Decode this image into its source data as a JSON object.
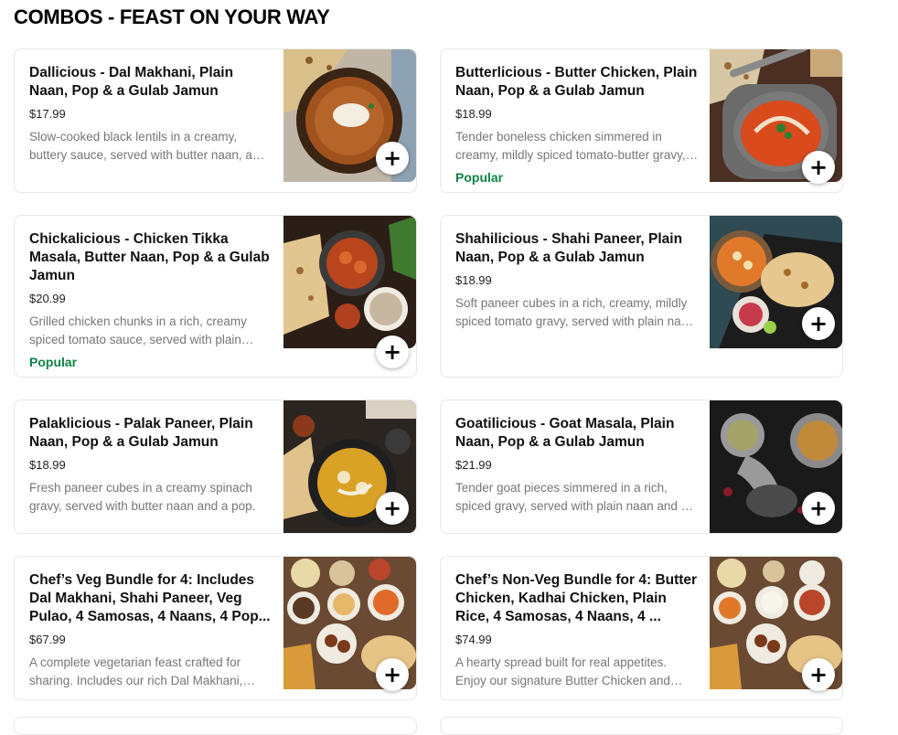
{
  "section": {
    "title": "COMBOS - FEAST ON YOUR WAY"
  },
  "items": [
    {
      "name": "Dallicious - Dal Makhani, Plain Naan, Pop & a Gulab Jamun",
      "price": "$17.99",
      "description": "Slow-cooked black lentils in a creamy, buttery sauce, served with butter naan, a pop, and a gulab jamun.",
      "badge": "",
      "image": "dal-makhani-photo",
      "add_icon": "+"
    },
    {
      "name": "Butterlicious - Butter Chicken, Plain Naan, Pop & a Gulab Jamun",
      "price": "$18.99",
      "description": "Tender boneless chicken simmered in creamy, mildly spiced tomato-butter gravy, served with plain naan, a pop, and a gulab jamun.",
      "badge": "Popular",
      "image": "butter-chicken-photo",
      "add_icon": "+"
    },
    {
      "name": "Chickalicious - Chicken Tikka Masala, Butter Naan, Pop & a Gulab Jamun",
      "price": "$20.99",
      "description": "Grilled chicken chunks in a rich, creamy spiced tomato sauce, served with plain naan, a pop, and a gulab jamun.",
      "badge": "Popular",
      "image": "chicken-tikka-masala-photo",
      "add_icon": "+"
    },
    {
      "name": "Shahilicious - Shahi Paneer, Plain Naan, Pop & a Gulab Jamun",
      "price": "$18.99",
      "description": "Soft paneer cubes in a rich, creamy, mildly spiced tomato gravy, served with plain naan, a pop, and a gulab jamun.",
      "badge": "",
      "image": "shahi-paneer-photo",
      "add_icon": "+"
    },
    {
      "name": "Palaklicious - Palak Paneer, Plain Naan, Pop & a Gulab Jamun",
      "price": "$18.99",
      "description": "Fresh paneer cubes in a creamy spinach gravy, served with butter naan and a pop.",
      "badge": "",
      "image": "palak-paneer-photo",
      "add_icon": "+"
    },
    {
      "name": "Goatilicious - Goat Masala, Plain Naan, Pop & a Gulab Jamun",
      "price": "$21.99",
      "description": "Tender goat pieces simmered in a rich, spiced gravy, served with plain naan and a pop.",
      "badge": "",
      "image": "goat-masala-photo",
      "add_icon": "+"
    },
    {
      "name": "Chef’s Veg Bundle for 4: Includes Dal Makhani, Shahi Paneer, Veg Pulao, 4 Samosas, 4 Naans, 4 Pop...",
      "price": "$67.99",
      "description": "A complete vegetarian feast crafted for sharing. Includes our rich Dal Makhani, creamy Shahi Paneer and more.",
      "badge": "",
      "image": "veg-bundle-photo",
      "add_icon": "+"
    },
    {
      "name": "Chef’s Non-Veg Bundle for 4: Butter Chicken, Kadhai Chicken, Plain Rice, 4 Samosas, 4 Naans, 4 ...",
      "price": "$74.99",
      "description": "A hearty spread built for real appetites. Enjoy our signature Butter Chicken and more.",
      "badge": "",
      "image": "non-veg-bundle-photo",
      "add_icon": "+"
    }
  ],
  "colors": {
    "popular": "#0e8345",
    "border": "#e8e8e8",
    "muted_text": "#767676"
  }
}
